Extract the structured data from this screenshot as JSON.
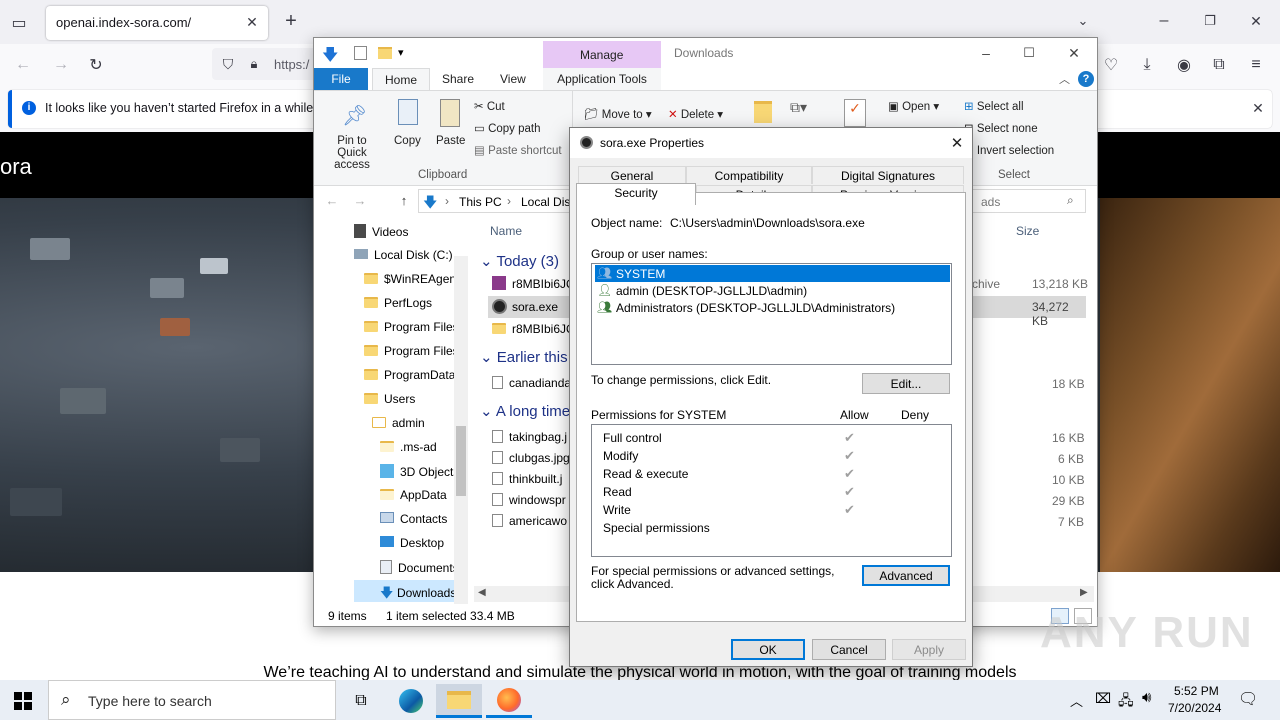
{
  "firefox": {
    "tab_title": "openai.index-sora.com/",
    "url_partial": "https:/",
    "notice_text": "It looks like you haven’t started Firefox in a while. D"
  },
  "website": {
    "logo_text": "ora",
    "tagline": "We’re teaching AI to understand and simulate the physical world in motion, with the goal of training models"
  },
  "explorer": {
    "title": "Downloads",
    "contextual_tab": "Manage",
    "ribbon_tabs": [
      "File",
      "Home",
      "Share",
      "View",
      "Application Tools"
    ],
    "clipboard": {
      "pin_label": "Pin to Quick access",
      "copy": "Copy",
      "paste": "Paste",
      "cut": "Cut",
      "copy_path": "Copy path",
      "paste_shortcut": "Paste shortcut",
      "group_label": "Clipboard"
    },
    "organize": {
      "move_to": "Move to",
      "delete": "Delete"
    },
    "open": {
      "open": "Open"
    },
    "select": {
      "select_all": "Select all",
      "select_none": "Select none",
      "invert": "Invert selection",
      "group_label": "Select"
    },
    "address": {
      "this_pc": "This PC",
      "local_disk": "Local Disk"
    },
    "search_tail": "ads",
    "nav_items": [
      "Videos",
      "Local Disk (C:)",
      "$WinREAgent",
      "PerfLogs",
      "Program Files",
      "Program Files",
      "ProgramData",
      "Users",
      "admin",
      ".ms-ad",
      "3D Objects",
      "AppData",
      "Contacts",
      "Desktop",
      "Documents",
      "Downloads"
    ],
    "columns": {
      "name": "Name",
      "size": "Size"
    },
    "groups": {
      "today": "Today (3)",
      "earlier": "Earlier this y",
      "long_ago": "A long time"
    },
    "files": [
      {
        "name": "r8MBIbi6JQ",
        "size": "13,218 KB",
        "type_tail": "chive"
      },
      {
        "name": "sora.exe",
        "size": "34,272 KB"
      },
      {
        "name": "r8MBIbi6JQ",
        "size": ""
      },
      {
        "name": "canadianda",
        "size": "18 KB"
      },
      {
        "name": "takingbag.j",
        "size": "16 KB"
      },
      {
        "name": "clubgas.jpg",
        "size": "6 KB"
      },
      {
        "name": "thinkbuilt.j",
        "size": "10 KB"
      },
      {
        "name": "windowspr",
        "size": "29 KB"
      },
      {
        "name": "americawo",
        "size": "7 KB"
      }
    ],
    "status": {
      "items": "9 items",
      "selected": "1 item selected  33.4 MB"
    }
  },
  "properties": {
    "title": "sora.exe Properties",
    "tabs_row1": [
      "General",
      "Compatibility",
      "Digital Signatures"
    ],
    "tabs_row2": [
      "Security",
      "Details",
      "Previous Versions"
    ],
    "object_name_label": "Object name:",
    "object_name_value": "C:\\Users\\admin\\Downloads\\sora.exe",
    "group_label": "Group or user names:",
    "users": [
      "SYSTEM",
      "admin (DESKTOP-JGLLJLD\\admin)",
      "Administrators (DESKTOP-JGLLJLD\\Administrators)"
    ],
    "change_text": "To change permissions, click Edit.",
    "edit_button": "Edit...",
    "permissions_label": "Permissions for SYSTEM",
    "allow": "Allow",
    "deny": "Deny",
    "permissions": [
      {
        "name": "Full control",
        "allow": true
      },
      {
        "name": "Modify",
        "allow": true
      },
      {
        "name": "Read & execute",
        "allow": true
      },
      {
        "name": "Read",
        "allow": true
      },
      {
        "name": "Write",
        "allow": true
      },
      {
        "name": "Special permissions",
        "allow": false
      }
    ],
    "advanced_text": "For special permissions or advanced settings, click Advanced.",
    "advanced_button": "Advanced",
    "ok": "OK",
    "cancel": "Cancel",
    "apply": "Apply"
  },
  "taskbar": {
    "search_placeholder": "Type here to search",
    "time": "5:52 PM",
    "date": "7/20/2024"
  },
  "watermark": "ANY RUN"
}
